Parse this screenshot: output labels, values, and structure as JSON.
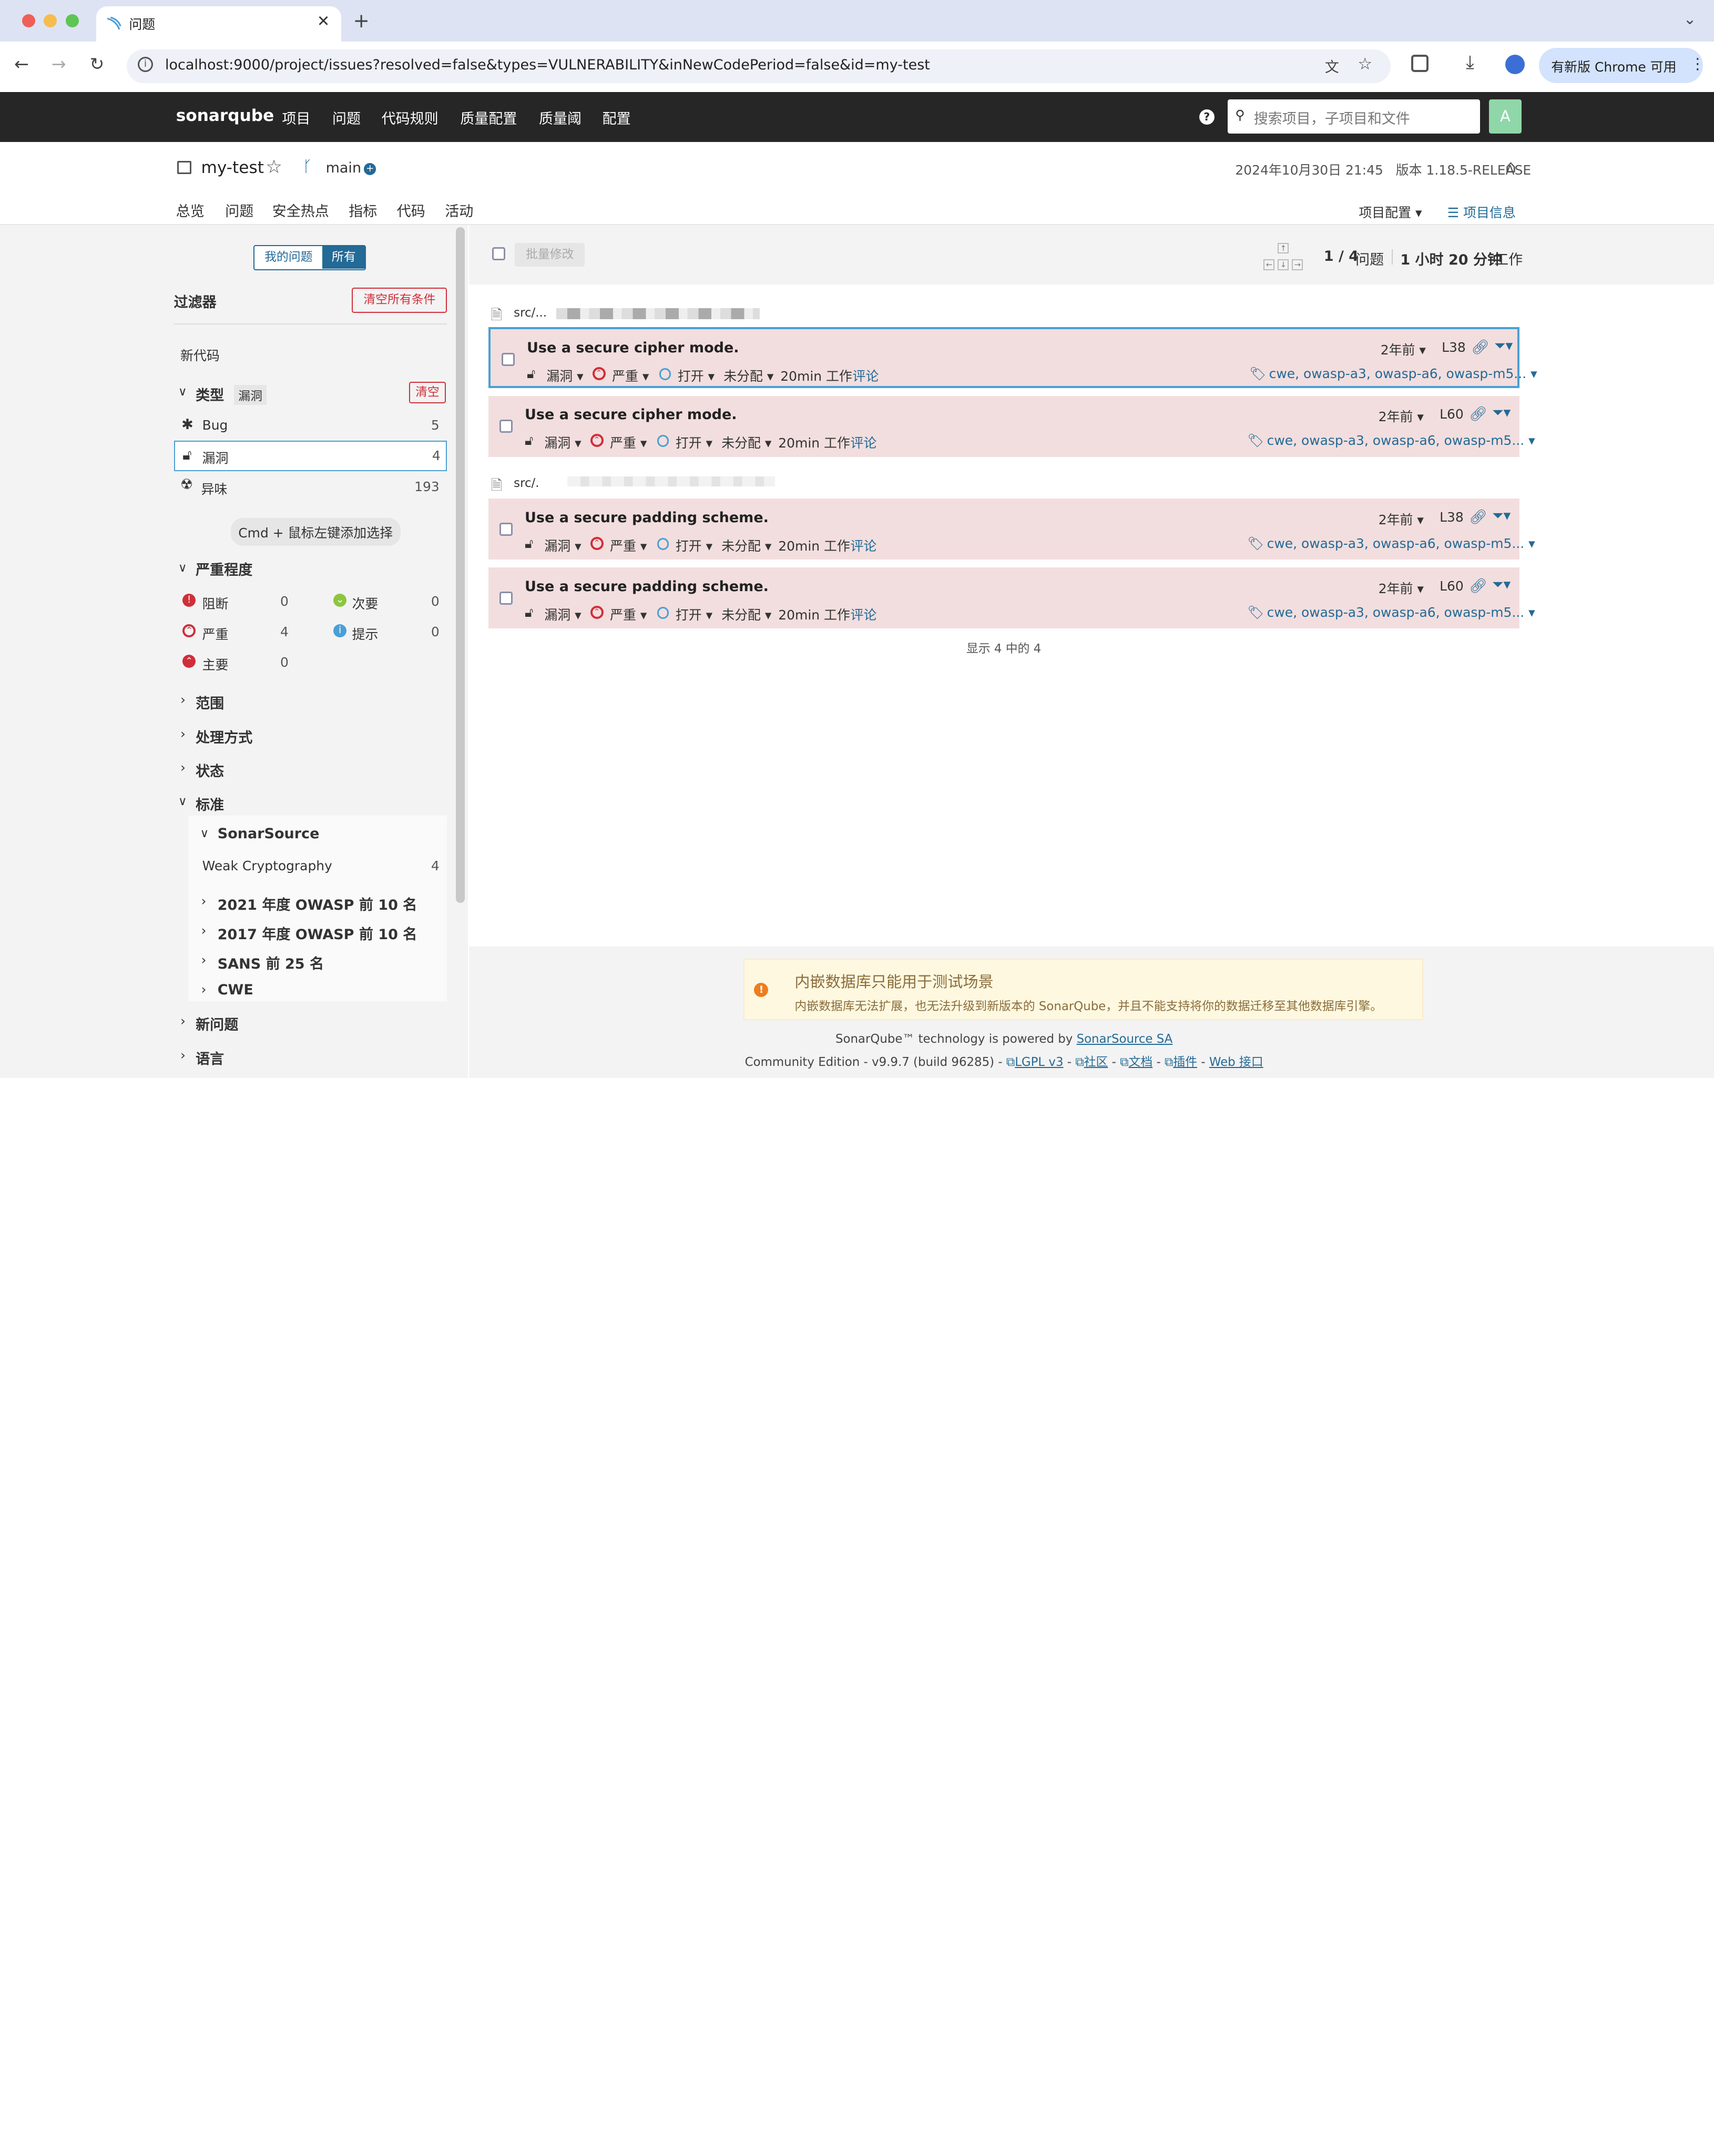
{
  "browser": {
    "tab_title": "问题",
    "url": "localhost:9000/project/issues?resolved=false&types=VULNERABILITY&inNewCodePeriod=false&id=my-test",
    "update_label": "有新版 Chrome 可用"
  },
  "nav": {
    "logo": "sonarqube",
    "items": [
      "项目",
      "问题",
      "代码规则",
      "质量配置",
      "质量阈",
      "配置"
    ],
    "search_placeholder": "搜索项目，子项目和文件",
    "avatar": "A"
  },
  "project": {
    "name": "my-test",
    "branch": "main",
    "meta": "2024年10月30日 21:45   版本 1.18.5-RELEASE",
    "tabs": [
      "总览",
      "问题",
      "安全热点",
      "指标",
      "代码",
      "活动"
    ],
    "config_label": "项目配置",
    "info_label": "项目信息"
  },
  "sidebar": {
    "my_issues": "我的问题",
    "all": "所有",
    "filter_title": "过滤器",
    "clear_all": "清空所有条件",
    "new_code": "新代码",
    "type_label": "类型",
    "type_badge": "漏洞",
    "clear": "清空",
    "types": [
      {
        "label": "Bug",
        "count": "5"
      },
      {
        "label": "漏洞",
        "count": "4"
      },
      {
        "label": "异味",
        "count": "193"
      }
    ],
    "hint": "Cmd + 鼠标左键添加选择",
    "severity_label": "严重程度",
    "severities": [
      {
        "label": "阻断",
        "count": "0"
      },
      {
        "label": "次要",
        "count": "0"
      },
      {
        "label": "严重",
        "count": "4"
      },
      {
        "label": "提示",
        "count": "0"
      },
      {
        "label": "主要",
        "count": "0"
      }
    ],
    "sections": [
      "范围",
      "处理方式",
      "状态"
    ],
    "standard_label": "标准",
    "sonarsource": "SonarSource",
    "weak_crypto": "Weak Cryptography",
    "weak_crypto_count": "4",
    "standards": [
      "2021 年度 OWASP 前 10 名",
      "2017 年度 OWASP 前 10 名",
      "SANS 前 25 名",
      "CWE"
    ],
    "more": [
      "新问题",
      "语言"
    ]
  },
  "toolbar": {
    "bulk": "批量修改",
    "issues_count": "1 / 4",
    "issues_label": "问题",
    "effort": "1 小时 20 分钟",
    "effort_label": "工作"
  },
  "files": [
    "src/...",
    "src/."
  ],
  "issue_common": {
    "type": "漏洞",
    "severity": "严重",
    "status": "打开",
    "assignee": "未分配",
    "effort": "20min 工作",
    "comment": "评论",
    "age": "2年前",
    "tags": "cwe, owasp-a3, owasp-a6, owasp-m5..."
  },
  "issues": [
    {
      "title": "Use a secure cipher mode.",
      "line": "L38"
    },
    {
      "title": "Use a secure cipher mode.",
      "line": "L60"
    },
    {
      "title": "Use a secure padding scheme.",
      "line": "L38"
    },
    {
      "title": "Use a secure padding scheme.",
      "line": "L60"
    }
  ],
  "shown": "显示 4 中的 4",
  "warning": {
    "title": "内嵌数据库只能用于测试场景",
    "body": "内嵌数据库无法扩展，也无法升级到新版本的 SonarQube，并且不能支持将你的数据迁移至其他数据库引擎。"
  },
  "footer": {
    "line1": "SonarQube™ technology is powered by",
    "sonarsource": "SonarSource SA",
    "edition": "Community Edition - v9.9.7 (build 96285) -",
    "links": [
      "LGPL v3",
      "社区",
      "文档",
      "插件",
      "Web 接口"
    ]
  }
}
